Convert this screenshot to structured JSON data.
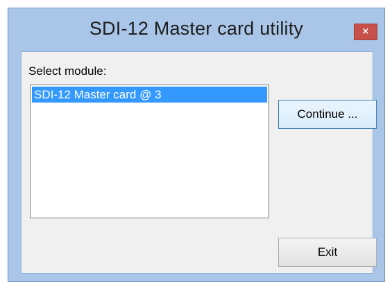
{
  "window": {
    "title": "SDI-12 Master card utility",
    "close_glyph": "×"
  },
  "module_select": {
    "label": "Select module:",
    "items": [
      {
        "label": "SDI-12 Master card @ 3",
        "selected": true
      }
    ]
  },
  "buttons": {
    "continue_label": "Continue ...",
    "exit_label": "Exit"
  },
  "colors": {
    "frame": "#a9c6e8",
    "close_button": "#c7504a",
    "selection": "#3399ff",
    "continue_focus_border": "#3c7fb1"
  },
  "icons": {
    "close": "close-icon"
  }
}
